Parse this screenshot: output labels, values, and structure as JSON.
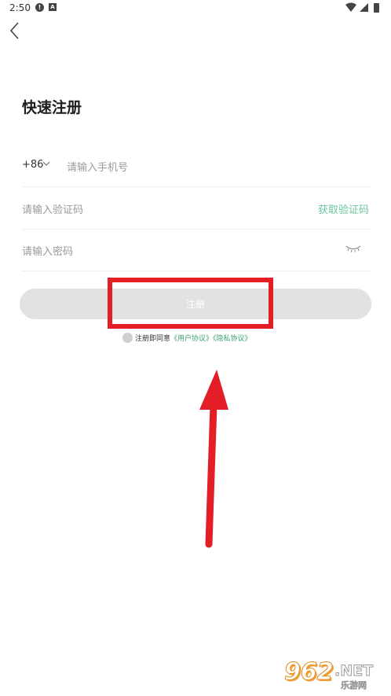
{
  "status_bar": {
    "time": "2:50",
    "alert_glyph": "!",
    "a_glyph": "A"
  },
  "header": {
    "title": "快速注册"
  },
  "phone": {
    "country_code": "+86",
    "placeholder": "请输入手机号"
  },
  "code": {
    "placeholder": "请输入验证码",
    "get_code_label": "获取验证码"
  },
  "password": {
    "placeholder": "请输入密码"
  },
  "register": {
    "label": "注册"
  },
  "agreement": {
    "prefix": "注册即同意",
    "user_link": "《用户协议》",
    "privacy_link": "《隐私协议》"
  },
  "watermark": {
    "number": "962",
    "suffix": ".NET",
    "cn": "乐游网"
  },
  "colors": {
    "accent_green": "#6cc6a0",
    "link_green": "#3aa26a",
    "highlight_red": "#e31e26",
    "button_gray": "#e2e2e2"
  }
}
